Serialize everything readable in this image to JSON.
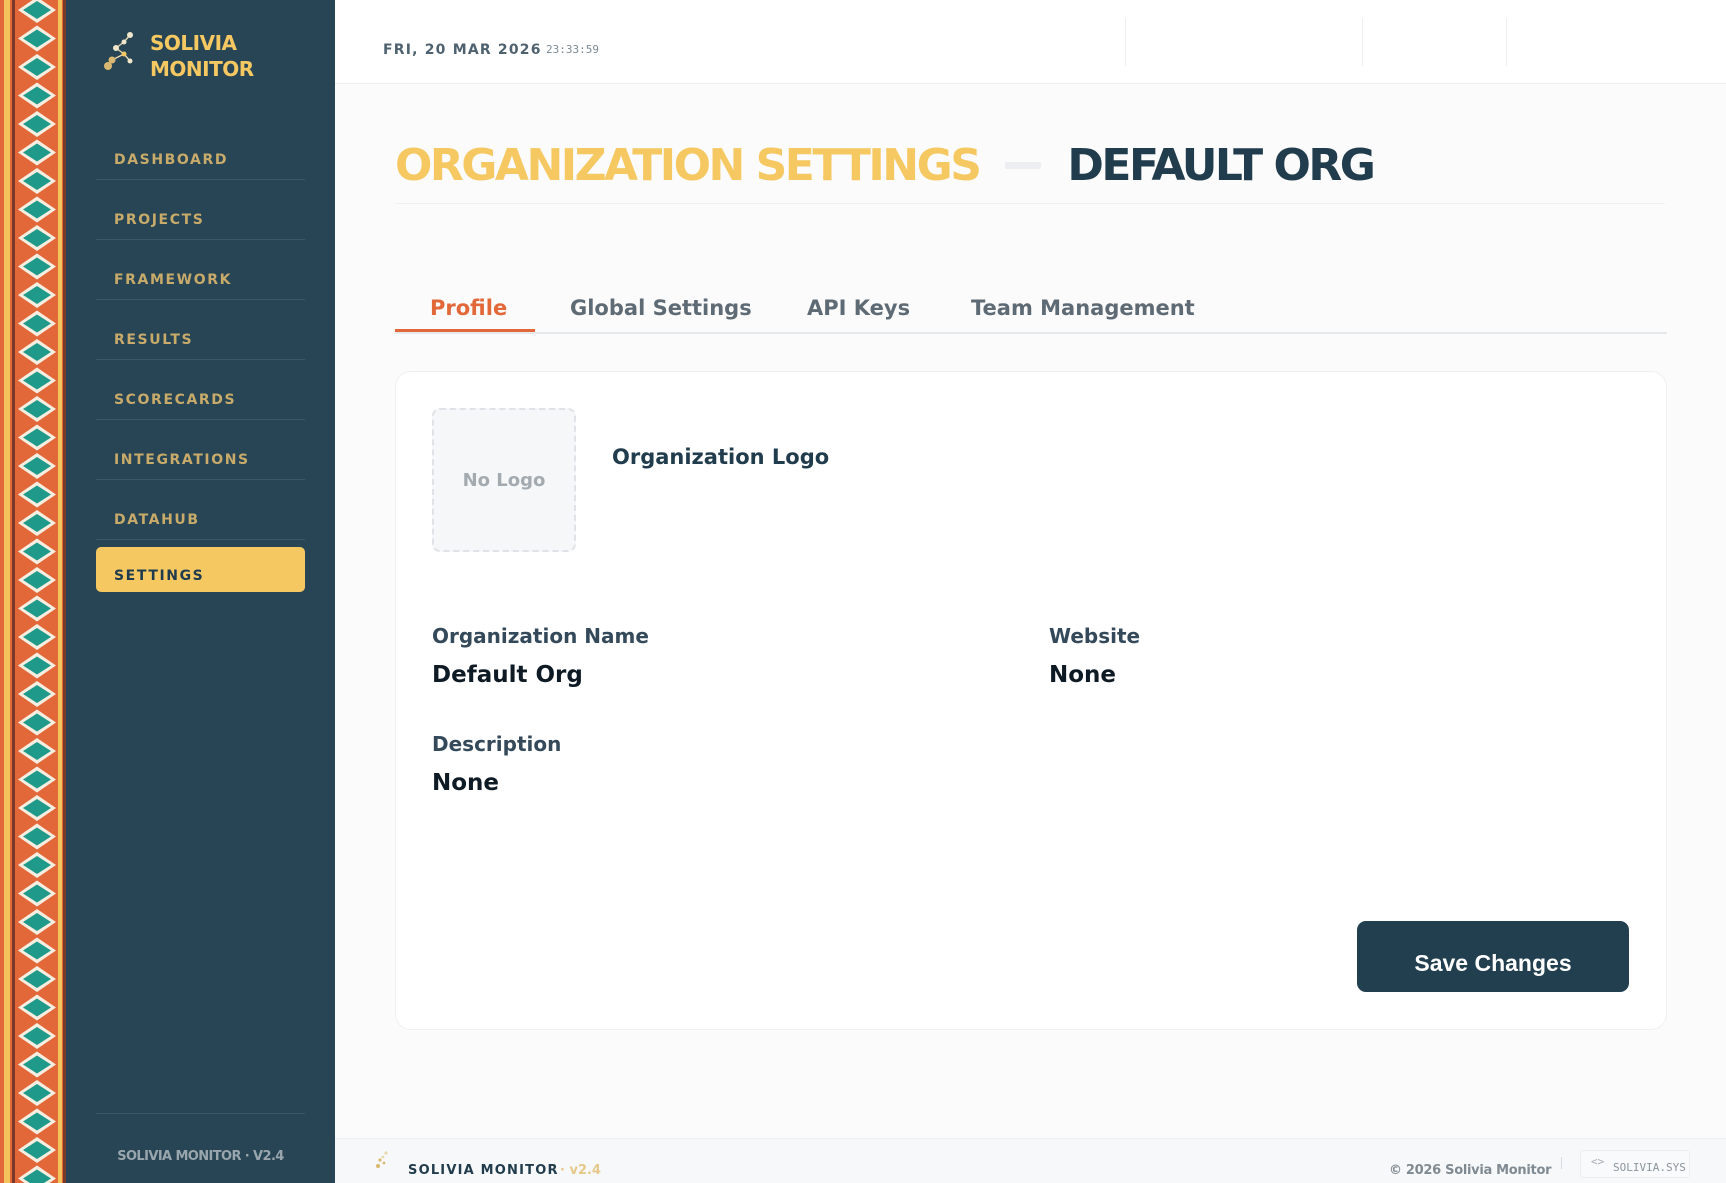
{
  "brand": {
    "line1": "SOLIVIA",
    "line2": "MONITOR",
    "accent": "#f5c862",
    "sidebar_bg": "#274554"
  },
  "nav": {
    "items": [
      {
        "label": "DASHBOARD"
      },
      {
        "label": "PROJECTS"
      },
      {
        "label": "FRAMEWORK"
      },
      {
        "label": "RESULTS"
      },
      {
        "label": "SCORECARDS"
      },
      {
        "label": "INTEGRATIONS"
      },
      {
        "label": "DATAHUB"
      },
      {
        "label": "SETTINGS",
        "active": true
      }
    ],
    "version": "SOLIVIA MONITOR · V2.4"
  },
  "header": {
    "date": "FRI, 20 MAR 2026",
    "time": "23:33:59"
  },
  "page": {
    "title_main": "ORGANIZATION SETTINGS",
    "title_sub": "DEFAULT ORG"
  },
  "tabs": [
    {
      "label": "Profile",
      "active": true
    },
    {
      "label": "Global Settings"
    },
    {
      "label": "API Keys"
    },
    {
      "label": "Team Management"
    }
  ],
  "profile": {
    "logo_placeholder": "No Logo",
    "logo_label": "Organization Logo",
    "name_label": "Organization Name",
    "name_value": "Default Org",
    "website_label": "Website",
    "website_value": "None",
    "description_label": "Description",
    "description_value": "None",
    "save_label": "Save Changes"
  },
  "footer": {
    "brand": "SOLIVIA MONITOR",
    "version": "· v2.4",
    "copyright": "© 2026 Solivia Monitor",
    "sys_icon": "<>",
    "sys_label": "SOLIVIA.SYS"
  },
  "colors": {
    "primary_dark": "#213f4e",
    "tab_active": "#e2683a"
  }
}
